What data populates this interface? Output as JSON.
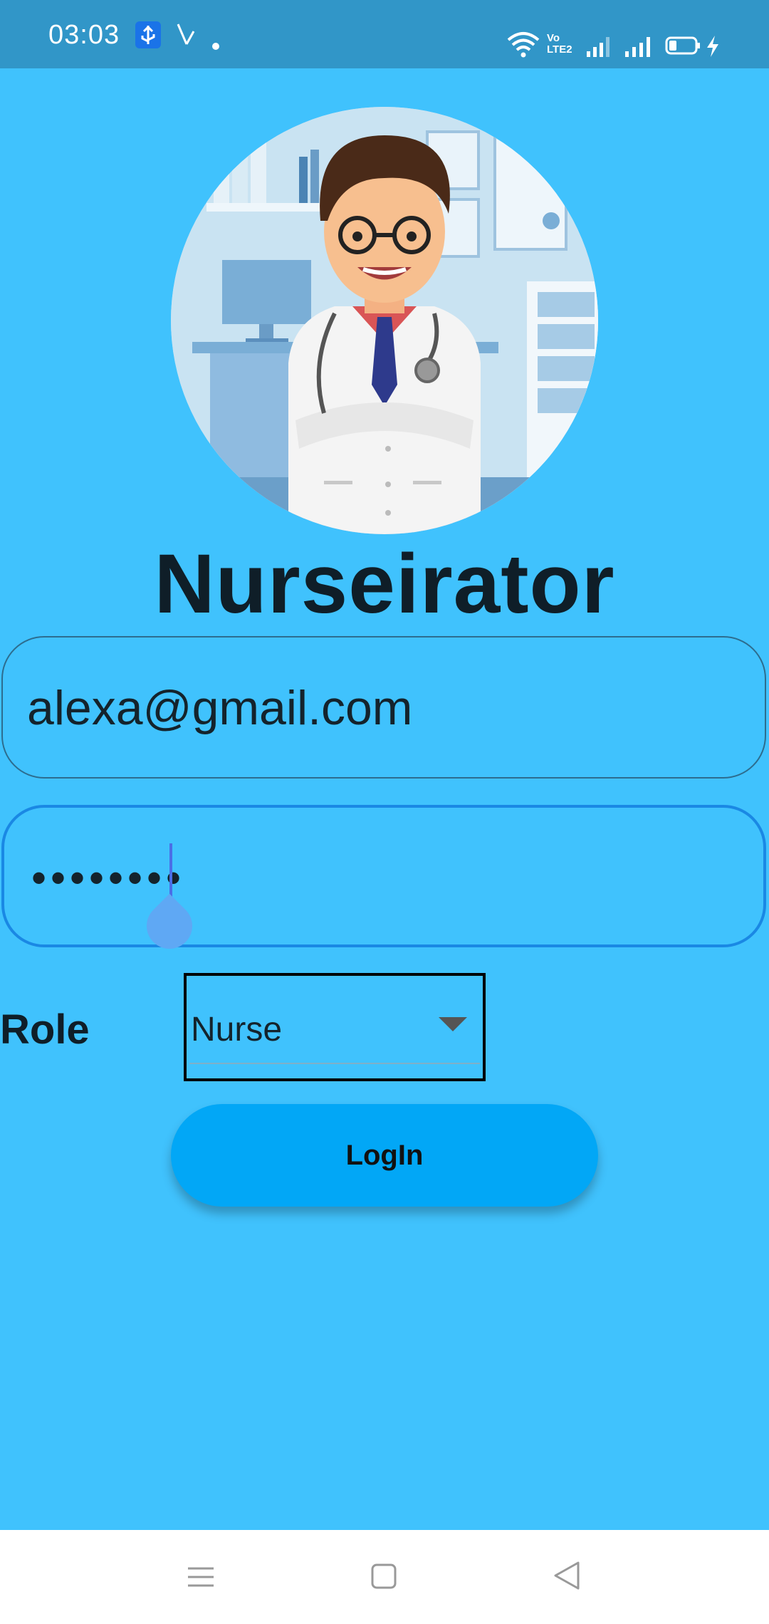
{
  "status_bar": {
    "time": "03:03",
    "volte_line1": "Vo",
    "volte_line2": "LTE2",
    "icons": [
      "usb-icon",
      "tool-icon",
      "dot-icon",
      "wifi-icon",
      "signal-icon",
      "signal-icon",
      "battery-icon",
      "charging-icon"
    ]
  },
  "app": {
    "title": "Nurseirator"
  },
  "form": {
    "email_value": "alexa@gmail.com",
    "password_value": "••••••••",
    "role_label": "Role",
    "role_selected": "Nurse",
    "login_label": "LogIn"
  },
  "colors": {
    "background": "#40c2fd",
    "status_bar": "#3196c8",
    "button": "#02a7f6",
    "focus_border": "#1a88e4"
  },
  "nav_bar": {
    "icons": [
      "menu-icon",
      "home-icon",
      "back-icon"
    ]
  }
}
